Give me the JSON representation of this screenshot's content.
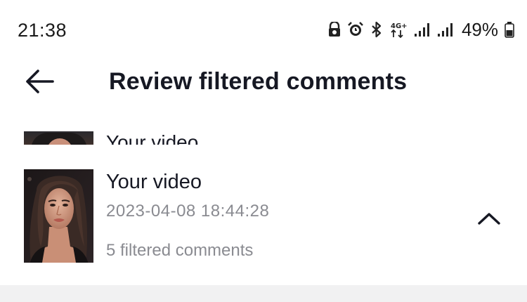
{
  "status_bar": {
    "time": "21:38",
    "battery_percent": "49%",
    "network_type": "4G+",
    "icons": [
      "app-lock-icon",
      "alarm-icon",
      "bluetooth-icon",
      "4g-plus-icon",
      "signal-icon",
      "signal-icon",
      "battery-icon"
    ]
  },
  "header": {
    "title": "Review filtered comments",
    "back_icon": "back-arrow-icon"
  },
  "list": {
    "items": [
      {
        "title": "Your video",
        "partial": true
      },
      {
        "title": "Your video",
        "timestamp": "2023-04-08 18:44:28",
        "filtered_count_label": "5 filtered comments",
        "expanded": true,
        "toggle_icon": "chevron-up-icon"
      }
    ]
  },
  "colors": {
    "primary_text": "#161823",
    "secondary_text": "#8a8b91",
    "background": "#ffffff",
    "divider_band": "#f1f1f2"
  }
}
